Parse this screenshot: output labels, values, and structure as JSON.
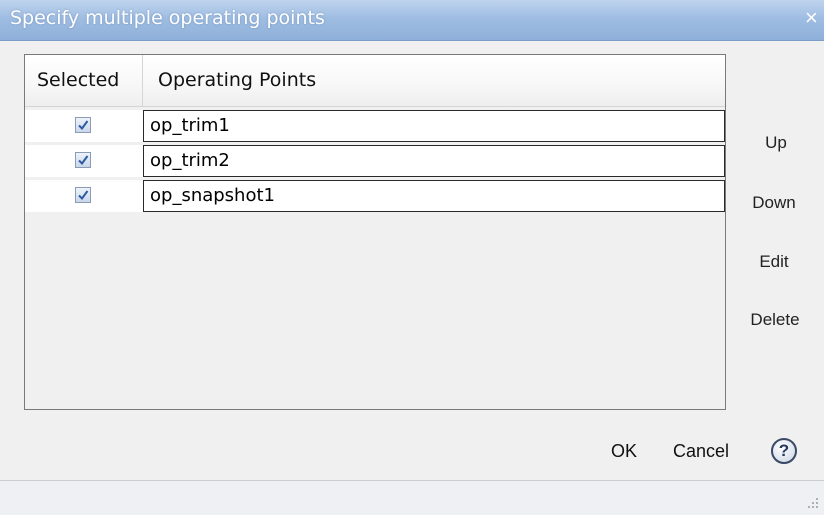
{
  "window": {
    "title": "Specify multiple operating points",
    "close_glyph": "×"
  },
  "table": {
    "columns": [
      "Selected",
      "Operating Points"
    ],
    "rows": [
      {
        "selected": true,
        "name": "op_trim1"
      },
      {
        "selected": true,
        "name": "op_trim2"
      },
      {
        "selected": true,
        "name": "op_snapshot1"
      }
    ]
  },
  "side_buttons": {
    "up": "Up",
    "down": "Down",
    "edit": "Edit",
    "delete": "Delete"
  },
  "footer": {
    "ok": "OK",
    "cancel": "Cancel",
    "help": "?"
  },
  "icons": {
    "close": "close-icon",
    "checkbox": "checkbox-checked-icon",
    "help": "help-icon",
    "resize": "resize-grip-icon"
  },
  "colors": {
    "title_bar": "#9fbde2",
    "dialog_bg": "#f0f0f0",
    "check_mark": "#2d5aa3"
  }
}
